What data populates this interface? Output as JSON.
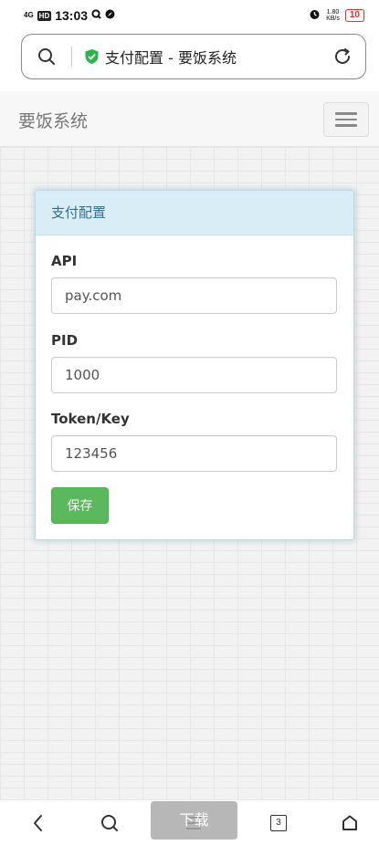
{
  "status_bar": {
    "network": "4G",
    "hd": "HD",
    "time": "13:03",
    "speed_value": "1.80",
    "speed_unit": "KB/s",
    "battery": "10"
  },
  "browser": {
    "page_title": "支付配置 - 要饭系统"
  },
  "navbar": {
    "brand": "要饭系统"
  },
  "panel": {
    "heading": "支付配置",
    "fields": [
      {
        "label": "API",
        "value": "pay.com"
      },
      {
        "label": "PID",
        "value": "1000"
      },
      {
        "label": "Token/Key",
        "value": "123456"
      }
    ],
    "save_label": "保存"
  },
  "bottom_nav": {
    "tab_count": "3",
    "download_label": "下载"
  },
  "colors": {
    "panel_heading_bg": "#d9edf7",
    "save_button": "#5cb85c",
    "secure_shield": "#2fb24a"
  }
}
